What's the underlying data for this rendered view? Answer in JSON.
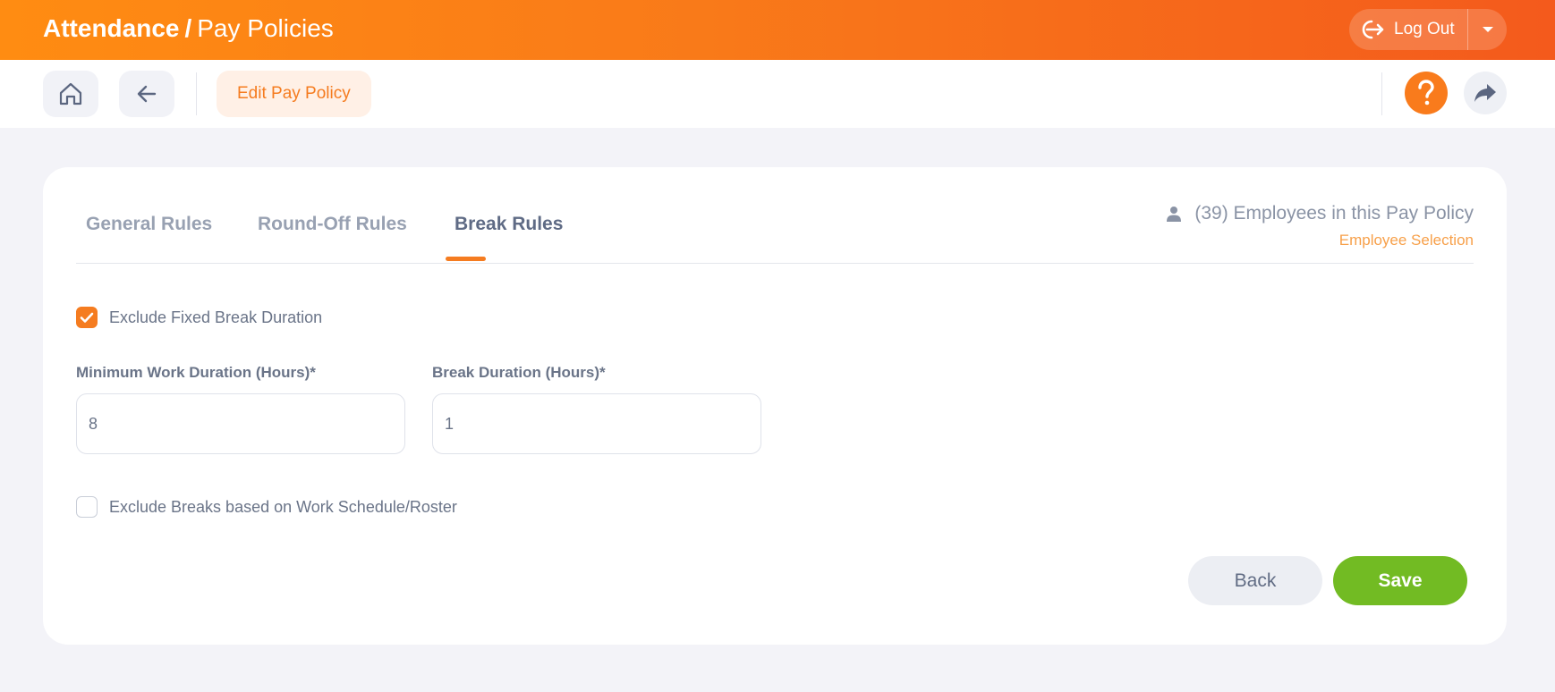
{
  "header": {
    "module": "Attendance",
    "separator": "/",
    "page": "Pay Policies",
    "logout_label": "Log Out"
  },
  "toolbar": {
    "chip_label": "Edit Pay Policy"
  },
  "tabs": [
    {
      "label": "General Rules",
      "active": false
    },
    {
      "label": "Round-Off Rules",
      "active": false
    },
    {
      "label": "Break Rules",
      "active": true
    }
  ],
  "employees": {
    "summary": "(39) Employees in this Pay Policy",
    "link": "Employee Selection"
  },
  "form": {
    "exclude_fixed": {
      "label": "Exclude Fixed Break Duration",
      "checked": true
    },
    "min_work": {
      "label": "Minimum Work Duration (Hours)*",
      "value": "8"
    },
    "break_duration": {
      "label": "Break Duration (Hours)*",
      "value": "1"
    },
    "exclude_schedule": {
      "label": "Exclude Breaks based on Work Schedule/Roster",
      "checked": false
    }
  },
  "actions": {
    "back_label": "Back",
    "save_label": "Save"
  },
  "colors": {
    "accent": "#f57c20",
    "save": "#72bb23"
  }
}
